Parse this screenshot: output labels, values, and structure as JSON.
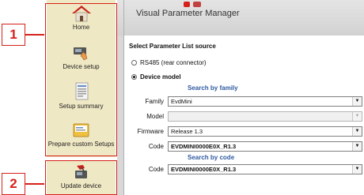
{
  "window": {
    "title": "Visual Parameter Manager"
  },
  "callouts": {
    "one": "1",
    "two": "2"
  },
  "sidebar": {
    "items": [
      {
        "label": "Home",
        "icon": "home-icon"
      },
      {
        "label": "Device setup",
        "icon": "device-setup-icon"
      },
      {
        "label": "Setup summary",
        "icon": "setup-summary-icon"
      },
      {
        "label": "Prepare custom Setups",
        "icon": "prepare-custom-setups-icon"
      },
      {
        "label": "Update device",
        "icon": "update-device-icon"
      }
    ]
  },
  "main": {
    "section_title": "Select Parameter List source",
    "options": {
      "rs485": "RS485 (rear connector)",
      "device_model": "Device model"
    },
    "search_by_family": {
      "heading": "Search by family",
      "family_label": "Family",
      "family_value": "EvdMini",
      "model_label": "Model",
      "model_value": "",
      "firmware_label": "Firmware",
      "firmware_value": "Release 1.3",
      "code_label": "Code",
      "code_value": "EVDMINI0000E0X_R1.3"
    },
    "search_by_code": {
      "heading": "Search by code",
      "code_label": "Code",
      "code_value": "EVDMINI0000E0X_R1.3"
    }
  },
  "colors": {
    "callout": "#d6201a",
    "sidebar": "#efe8c4",
    "subhead": "#2f5aa0"
  }
}
